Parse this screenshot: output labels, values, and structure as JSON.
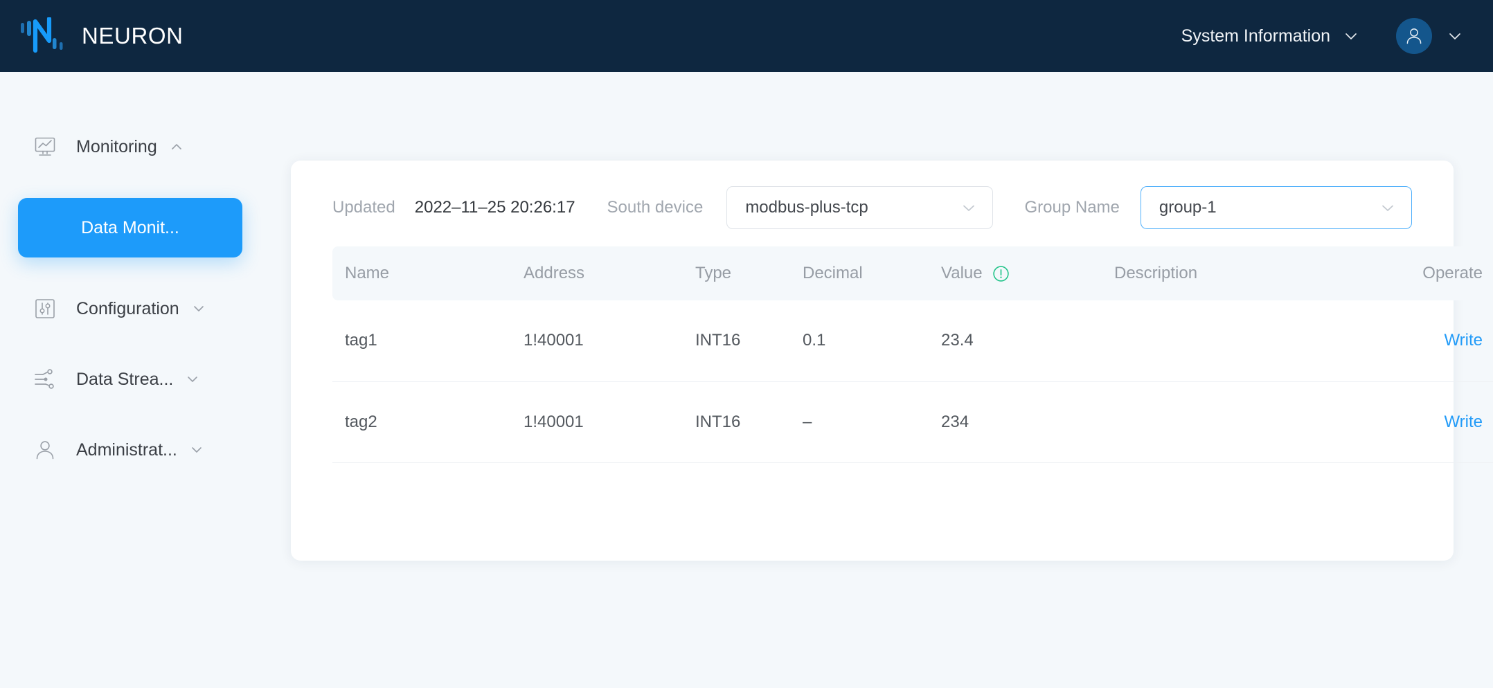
{
  "header": {
    "brand_name": "NEURON",
    "logo_icon": "neuron-logo-icon",
    "system_information_label": "System Information",
    "system_information_chevron": "chevron-down-icon",
    "avatar_icon": "user-avatar-icon",
    "avatar_chevron": "chevron-down-icon",
    "background_color": "#0e2740",
    "avatar_color": "#14568c"
  },
  "sidebar": {
    "items": [
      {
        "label": "Monitoring",
        "icon": "monitor-chart-icon",
        "chevron": "chevron-up-icon",
        "expanded": true
      },
      {
        "label": "Configuration",
        "icon": "sliders-icon",
        "chevron": "chevron-down-icon",
        "expanded": false
      },
      {
        "label": "Data Strea...",
        "icon": "data-stream-icon",
        "chevron": "chevron-down-icon",
        "expanded": false
      },
      {
        "label": "Administrat...",
        "icon": "person-icon",
        "chevron": "chevron-down-icon",
        "expanded": false
      }
    ],
    "active_subitem": {
      "label": "Data Monit...",
      "accent_color": "#1d9bfa"
    }
  },
  "main": {
    "filter_bar": {
      "updated_label": "Updated",
      "updated_value": "2022–11–25 20:26:17",
      "south_device_label": "South device",
      "south_device_value": "modbus-plus-tcp",
      "south_device_chevron": "chevron-down-icon",
      "group_name_label": "Group Name",
      "group_name_value": "group-1",
      "group_name_chevron": "chevron-down-icon",
      "group_name_focused": true,
      "focus_color": "#4eaffb"
    },
    "table": {
      "columns": [
        "Name",
        "Address",
        "Type",
        "Decimal",
        "Value",
        "Description",
        "Operate"
      ],
      "value_header_icon": "exclamation-circle-icon",
      "value_header_icon_color": "#23c48a",
      "rows": [
        {
          "name": "tag1",
          "address": "1!40001",
          "type": "INT16",
          "decimal": "0.1",
          "value": "23.4",
          "description": "",
          "operate": "Write"
        },
        {
          "name": "tag2",
          "address": "1!40001",
          "type": "INT16",
          "decimal": "–",
          "value": "234",
          "description": "",
          "operate": "Write"
        }
      ],
      "link_color": "#229bf8"
    }
  }
}
